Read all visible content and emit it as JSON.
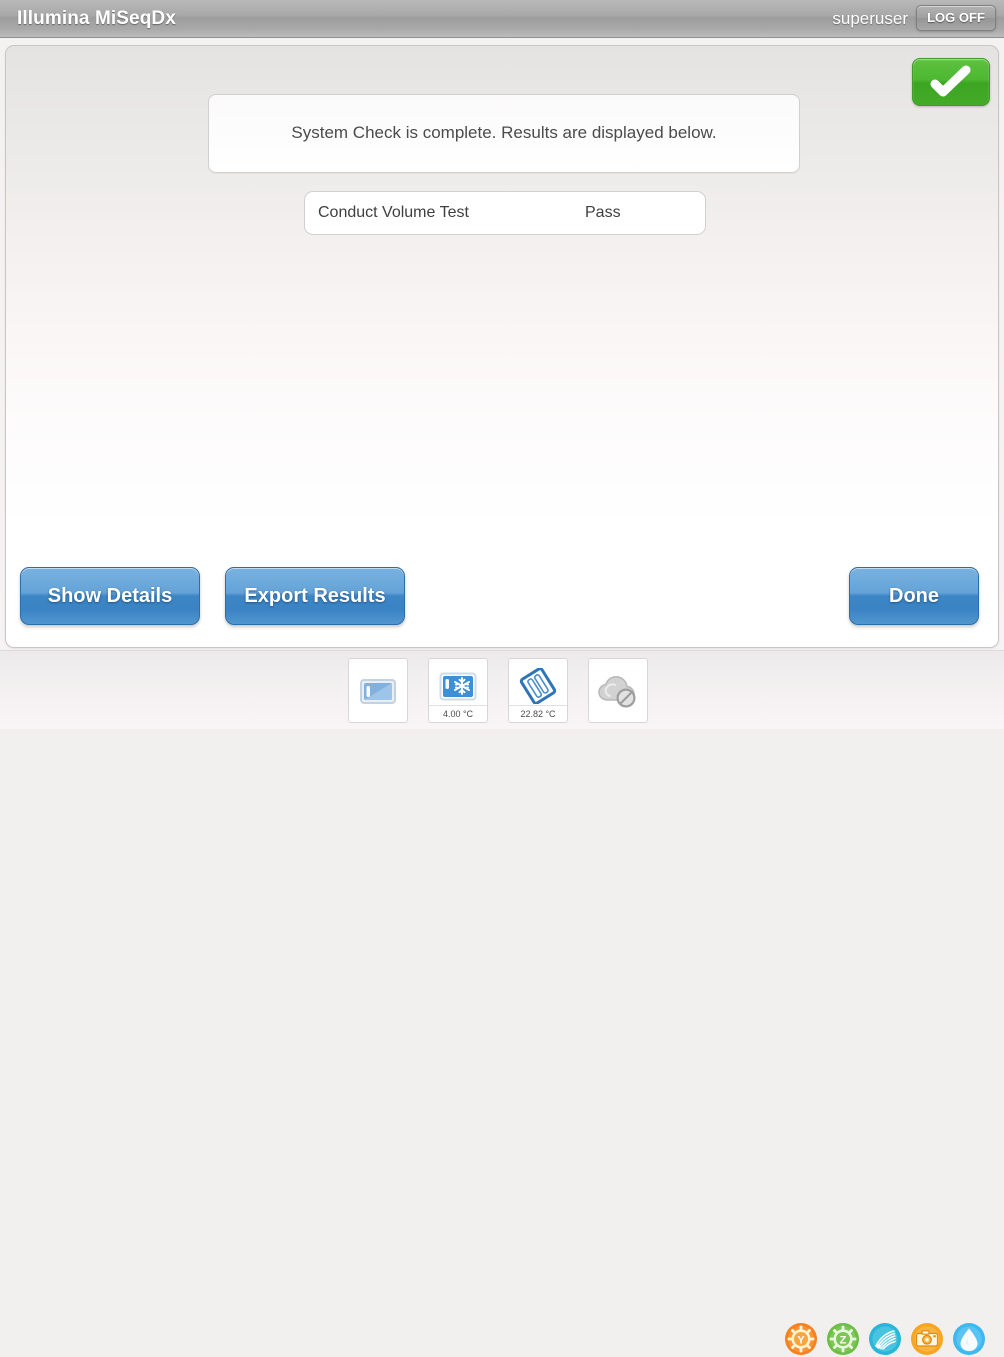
{
  "titlebar": {
    "app_title": "Illumina MiSeqDx",
    "user": "superuser",
    "logoff_label": "LOG OFF"
  },
  "main": {
    "status_badge": {
      "icon": "check-icon",
      "state": "pass",
      "color": "#46ad2a"
    },
    "message": "System Check is complete. Results are displayed below.",
    "results": [
      {
        "name": "Conduct Volume Test",
        "status": "Pass"
      }
    ],
    "buttons": {
      "show_details": "Show Details",
      "export_results": "Export Results",
      "done": "Done"
    },
    "accent_color": "#3d86c6"
  },
  "statusbar": {
    "hardware": [
      {
        "icon": "flow-cell-tray-icon",
        "label": "",
        "temp": ""
      },
      {
        "icon": "reagent-cooler-snowflake-icon",
        "label": "",
        "temp": "4.00 °C"
      },
      {
        "icon": "flow-cell-icon",
        "label": "",
        "temp": "22.82 °C"
      },
      {
        "icon": "cloud-disconnected-icon",
        "label": "",
        "temp": ""
      }
    ],
    "sensors": [
      {
        "icon": "y-motor-gear-icon",
        "label": "Y",
        "color": "#f58220"
      },
      {
        "icon": "z-motor-gear-icon",
        "label": "Z",
        "color": "#6cbe45"
      },
      {
        "icon": "sensor-scan-icon",
        "label": "",
        "color": "#29b6d8"
      },
      {
        "icon": "camera-icon",
        "label": "",
        "color": "#f6a623"
      },
      {
        "icon": "fluidics-drop-icon",
        "label": "",
        "color": "#3fb8ef"
      }
    ]
  }
}
